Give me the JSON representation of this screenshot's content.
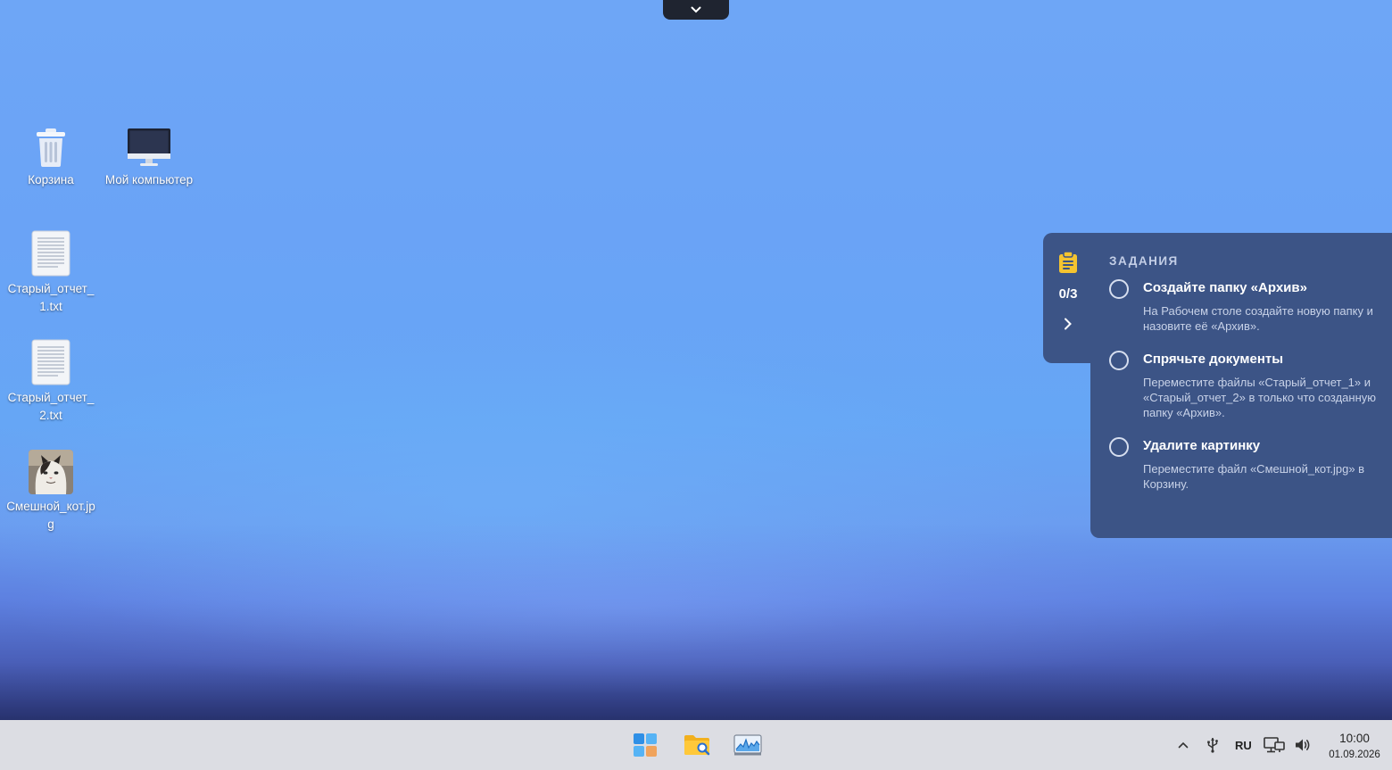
{
  "desktop": {
    "icons": [
      {
        "label": "Корзина",
        "icon": "trash-icon"
      },
      {
        "label": "Мой компьютер",
        "icon": "monitor-icon"
      },
      {
        "label": "Старый_отчет_1.txt",
        "icon": "text-file-icon"
      },
      {
        "label": "Старый_отчет_2.txt",
        "icon": "text-file-icon"
      },
      {
        "label": "Смешной_кот.jpg",
        "icon": "image-file-icon"
      }
    ]
  },
  "tasks": {
    "heading": "ЗАДАНИЯ",
    "progress": "0/3",
    "items": [
      {
        "title": "Создайте папку «Архив»",
        "description": "На Рабочем столе создайте новую папку и назовите её «Архив».",
        "done": false
      },
      {
        "title": "Спрячьте документы",
        "description": "Переместите файлы «Старый_отчет_1» и «Старый_отчет_2» в только что созданную папку «Архив».",
        "done": false
      },
      {
        "title": "Удалите картинку",
        "description": "Переместите файл «Смешной_кот.jpg» в Корзину.",
        "done": false
      }
    ]
  },
  "taskbar": {
    "apps": [
      "start-menu-icon",
      "file-manager-icon",
      "system-monitor-icon"
    ],
    "tray": {
      "language": "RU"
    },
    "clock": {
      "time": "10:00",
      "date": "01.09.2026"
    }
  },
  "colors": {
    "panel": "#3c5486",
    "accent_clipboard": "#f4c430",
    "taskbar": "#dcdde3"
  }
}
